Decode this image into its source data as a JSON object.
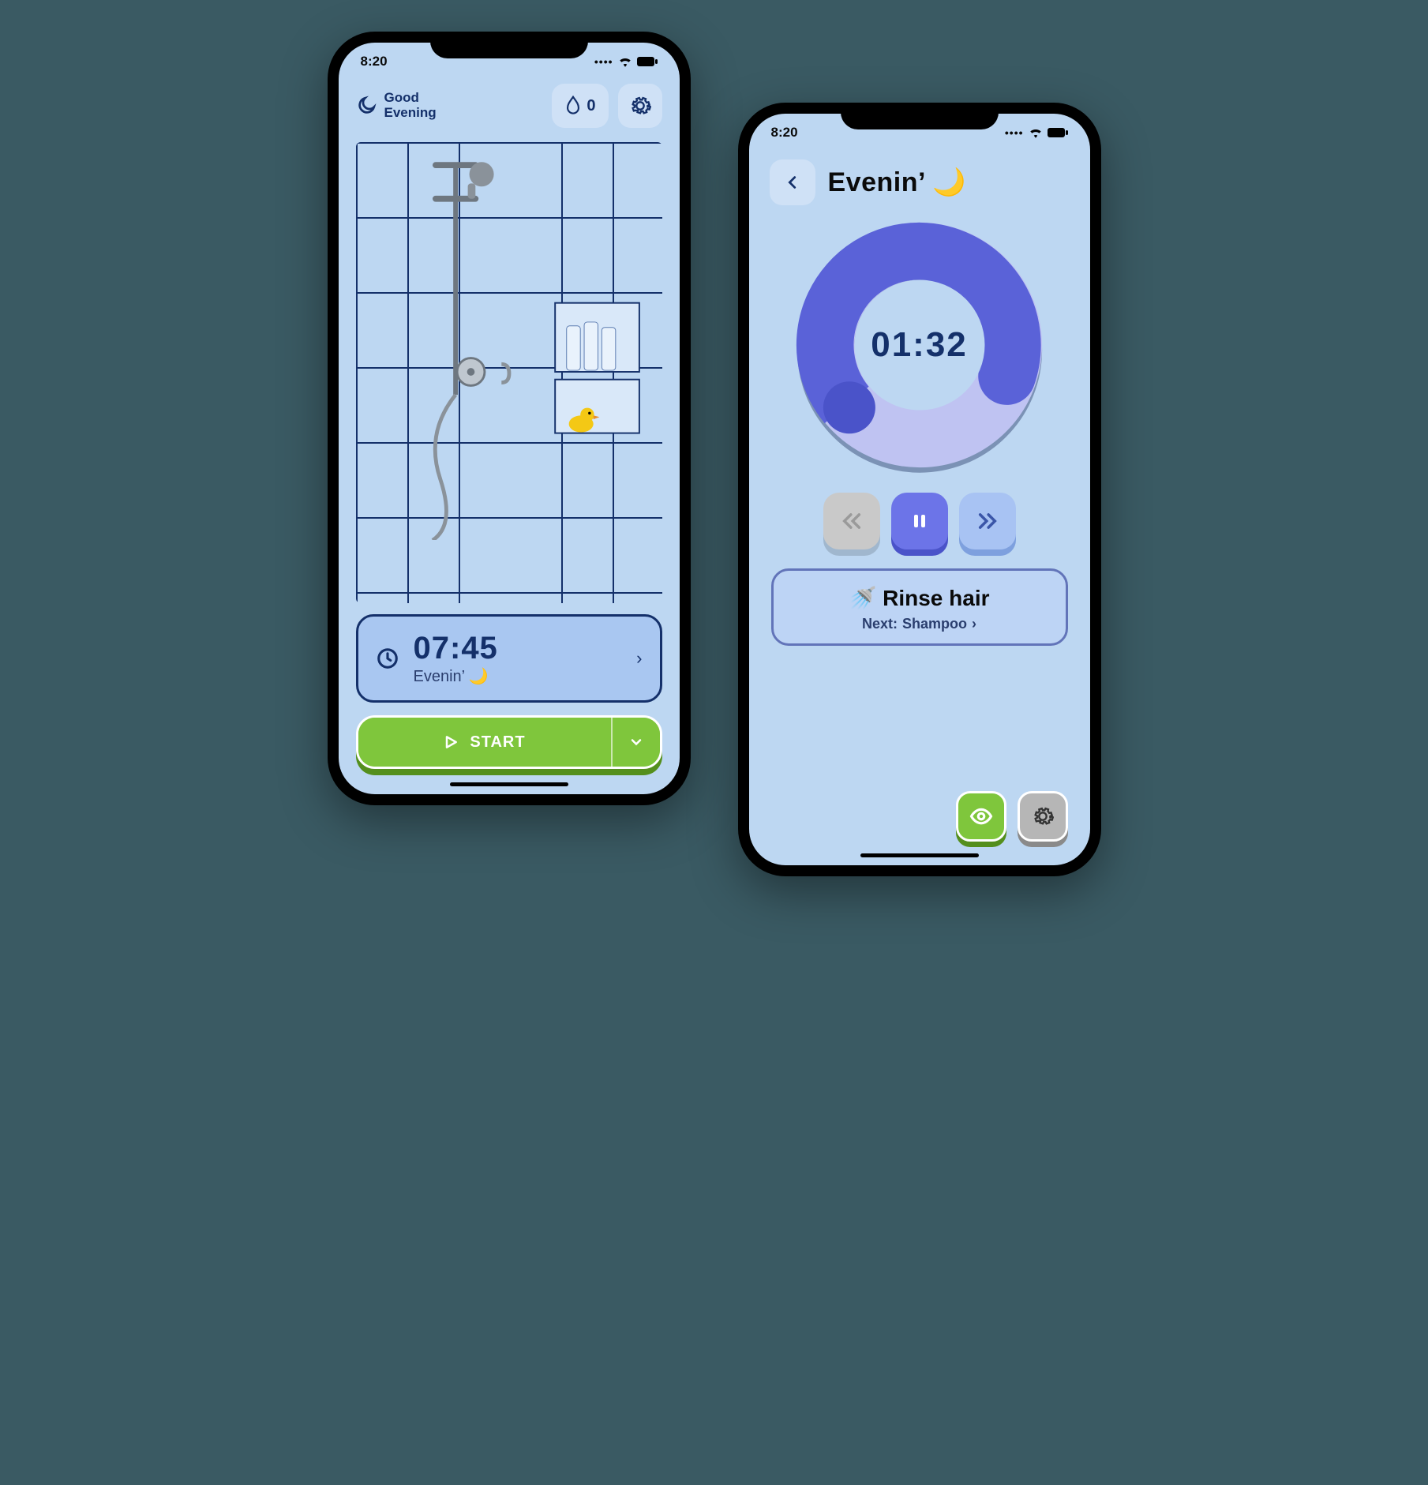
{
  "status": {
    "time": "8:20"
  },
  "phone1": {
    "greeting_line1": "Good",
    "greeting_line2": "Evening",
    "drops_count": "0",
    "routine": {
      "time": "07:45",
      "name": "Evenin’ 🌙"
    },
    "start_label": "START"
  },
  "phone2": {
    "title": "Evenin’ 🌙",
    "timer": "01:32",
    "progress_pct": 35,
    "step": {
      "emoji": "🚿",
      "title": "Rinse hair",
      "next_prefix": "Next: ",
      "next_name": "Shampoo"
    }
  }
}
